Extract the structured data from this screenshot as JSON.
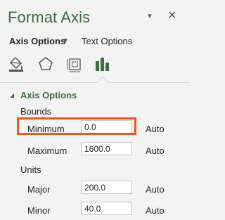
{
  "header": {
    "title": "Format Axis",
    "pin_glyph": "▼",
    "close_glyph": "✕"
  },
  "tabs": {
    "axis_options_label": "Axis Options",
    "axis_options_caret": "▼",
    "text_options_label": "Text Options"
  },
  "icon_buttons": [
    {
      "name": "fill-line-icon"
    },
    {
      "name": "effects-icon"
    },
    {
      "name": "size-properties-icon"
    },
    {
      "name": "axis-options-chart-icon",
      "selected": true
    }
  ],
  "section": {
    "caret": "◢",
    "title": "Axis Options"
  },
  "bounds": {
    "label": "Bounds",
    "minimum": {
      "label": "Minimum",
      "value": "0.0",
      "auto_label": "Auto"
    },
    "maximum": {
      "label": "Maximum",
      "value": "1600.0",
      "auto_label": "Auto"
    }
  },
  "units": {
    "label": "Units",
    "major": {
      "label": "Major",
      "value": "200.0",
      "auto_label": "Auto"
    },
    "minor": {
      "label": "Minor",
      "value": "40.0",
      "auto_label": "Auto"
    }
  },
  "colors": {
    "accent_green": "#3e6e3e",
    "highlight_orange": "#e8571e",
    "panel_bg": "#f3f3f3"
  }
}
